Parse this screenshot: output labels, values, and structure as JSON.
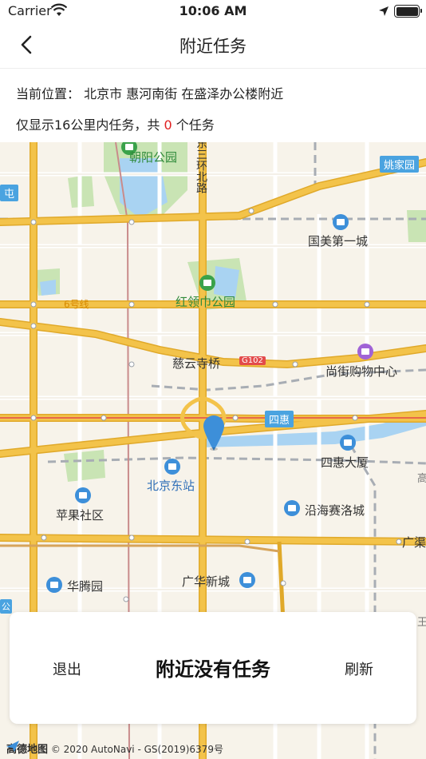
{
  "status_bar": {
    "carrier": "Carrier",
    "time": "10:06 AM",
    "icons": [
      "wifi-icon",
      "location-arrow-icon",
      "battery-icon"
    ]
  },
  "nav": {
    "title": "附近任务",
    "back_icon": "chevron-left-icon"
  },
  "info": {
    "location_prefix": "当前位置：",
    "location": "北京市 惠河南街 在盛泽办公楼附近",
    "range_prefix": "仅显示16公里内任务，共",
    "count": "0",
    "range_suffix": "个任务"
  },
  "map": {
    "labels": {
      "chaoyang_park": "朝阳公园",
      "ring_road": "东三环北路",
      "yaojiayuan": "姚家园",
      "tun": "屯",
      "guomei": "国美第一城",
      "line6": "6号线",
      "hongling": "红领巾公园",
      "ciyunsi": "慈云寺桥",
      "g102": "G102",
      "shangjie": "尚街购物中心",
      "sihui": "四惠",
      "sihui_tower": "四惠大厦",
      "beijing_east": "北京东站",
      "pingguo": "苹果社区",
      "yanhai": "沿海赛洛城",
      "guangqu": "广渠",
      "huateng": "华腾园",
      "guanghua": "广华新城",
      "gong": "公",
      "right_edge": "高",
      "right_edge2": "王"
    },
    "attribution_logo": "高德地图",
    "attribution": "© 2020 AutoNavi - GS(2019)6379号",
    "colors": {
      "background": "#f7f3ea",
      "major_road": "#f3c34a",
      "road_outline": "#e0a92a",
      "water": "#a9d3f2",
      "park": "#c9e4b4",
      "rail": "#9aa0a8",
      "pin": "#3d8fd9"
    }
  },
  "panel": {
    "exit_label": "退出",
    "message": "附近没有任务",
    "refresh_label": "刷新"
  }
}
